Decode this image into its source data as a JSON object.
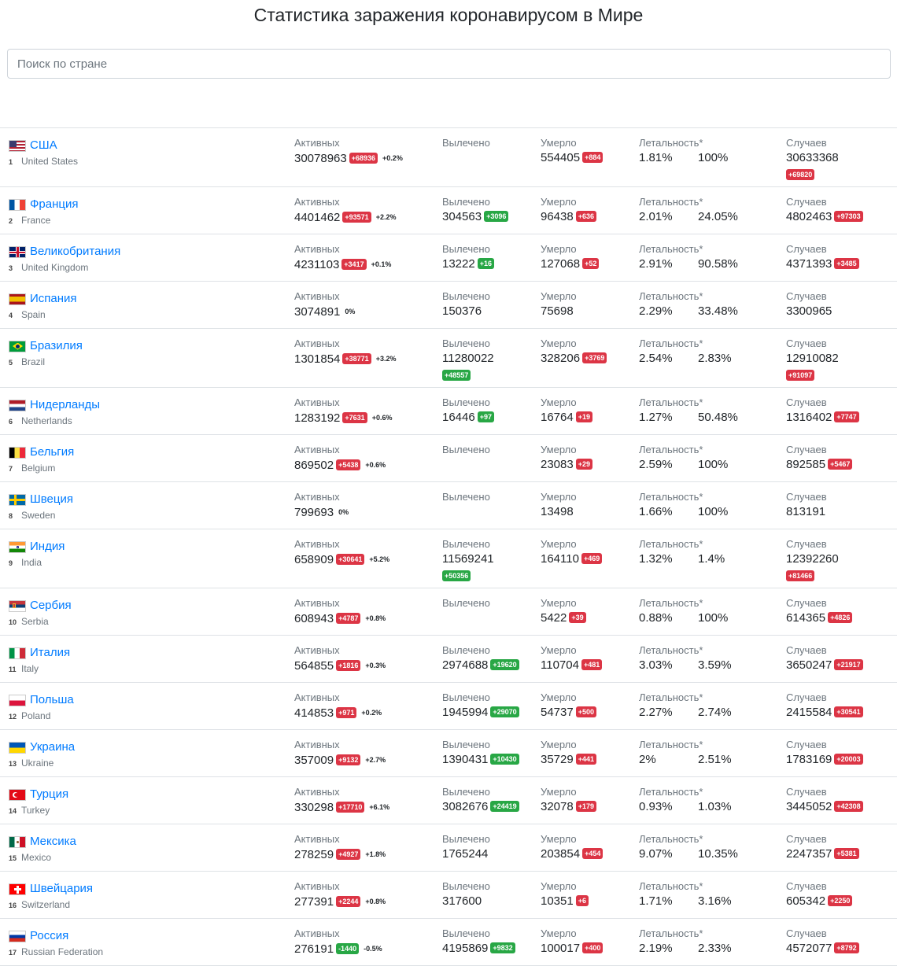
{
  "page_title": "Статистика заражения коронавирусом в Мире",
  "search": {
    "placeholder": "Поиск по стране"
  },
  "labels": {
    "active": "Активных",
    "recovered": "Вылечено",
    "deaths": "Умерло",
    "lethality": "Летальность*",
    "cases": "Случаев"
  },
  "rows": [
    {
      "rank": "1",
      "name": "США",
      "en": "United States",
      "flag": "us",
      "active": "30078963",
      "active_delta": "+68936",
      "active_pct": "+0.2%",
      "recovered": "",
      "recovered_delta": "",
      "deaths": "554405",
      "deaths_delta": "+884",
      "lethal": "1.81%",
      "lethal2": "100%",
      "cases": "30633368",
      "cases_delta": "+69820"
    },
    {
      "rank": "2",
      "name": "Франция",
      "en": "France",
      "flag": "fr",
      "active": "4401462",
      "active_delta": "+93571",
      "active_pct": "+2.2%",
      "recovered": "304563",
      "recovered_delta": "+3096",
      "deaths": "96438",
      "deaths_delta": "+636",
      "lethal": "2.01%",
      "lethal2": "24.05%",
      "cases": "4802463",
      "cases_delta": "+97303"
    },
    {
      "rank": "3",
      "name": "Великобритания",
      "en": "United Kingdom",
      "flag": "gb",
      "active": "4231103",
      "active_delta": "+3417",
      "active_pct": "+0.1%",
      "recovered": "13222",
      "recovered_delta": "+16",
      "deaths": "127068",
      "deaths_delta": "+52",
      "lethal": "2.91%",
      "lethal2": "90.58%",
      "cases": "4371393",
      "cases_delta": "+3485"
    },
    {
      "rank": "4",
      "name": "Испания",
      "en": "Spain",
      "flag": "es",
      "active": "3074891",
      "active_delta": "",
      "active_pct": "0%",
      "recovered": "150376",
      "recovered_delta": "",
      "deaths": "75698",
      "deaths_delta": "",
      "lethal": "2.29%",
      "lethal2": "33.48%",
      "cases": "3300965",
      "cases_delta": ""
    },
    {
      "rank": "5",
      "name": "Бразилия",
      "en": "Brazil",
      "flag": "br",
      "active": "1301854",
      "active_delta": "+38771",
      "active_pct": "+3.2%",
      "recovered": "11280022",
      "recovered_delta": "+48557",
      "deaths": "328206",
      "deaths_delta": "+3769",
      "lethal": "2.54%",
      "lethal2": "2.83%",
      "cases": "12910082",
      "cases_delta": "+91097"
    },
    {
      "rank": "6",
      "name": "Нидерланды",
      "en": "Netherlands",
      "flag": "nl",
      "active": "1283192",
      "active_delta": "+7631",
      "active_pct": "+0.6%",
      "recovered": "16446",
      "recovered_delta": "+97",
      "deaths": "16764",
      "deaths_delta": "+19",
      "lethal": "1.27%",
      "lethal2": "50.48%",
      "cases": "1316402",
      "cases_delta": "+7747"
    },
    {
      "rank": "7",
      "name": "Бельгия",
      "en": "Belgium",
      "flag": "be",
      "active": "869502",
      "active_delta": "+5438",
      "active_pct": "+0.6%",
      "recovered": "",
      "recovered_delta": "",
      "deaths": "23083",
      "deaths_delta": "+29",
      "lethal": "2.59%",
      "lethal2": "100%",
      "cases": "892585",
      "cases_delta": "+5467"
    },
    {
      "rank": "8",
      "name": "Швеция",
      "en": "Sweden",
      "flag": "se",
      "active": "799693",
      "active_delta": "",
      "active_pct": "0%",
      "recovered": "",
      "recovered_delta": "",
      "deaths": "13498",
      "deaths_delta": "",
      "lethal": "1.66%",
      "lethal2": "100%",
      "cases": "813191",
      "cases_delta": ""
    },
    {
      "rank": "9",
      "name": "Индия",
      "en": "India",
      "flag": "in",
      "active": "658909",
      "active_delta": "+30641",
      "active_pct": "+5.2%",
      "recovered": "11569241",
      "recovered_delta": "+50356",
      "deaths": "164110",
      "deaths_delta": "+469",
      "lethal": "1.32%",
      "lethal2": "1.4%",
      "cases": "12392260",
      "cases_delta": "+81466"
    },
    {
      "rank": "10",
      "name": "Сербия",
      "en": "Serbia",
      "flag": "rs",
      "active": "608943",
      "active_delta": "+4787",
      "active_pct": "+0.8%",
      "recovered": "",
      "recovered_delta": "",
      "deaths": "5422",
      "deaths_delta": "+39",
      "lethal": "0.88%",
      "lethal2": "100%",
      "cases": "614365",
      "cases_delta": "+4826"
    },
    {
      "rank": "11",
      "name": "Италия",
      "en": "Italy",
      "flag": "it",
      "active": "564855",
      "active_delta": "+1816",
      "active_pct": "+0.3%",
      "recovered": "2974688",
      "recovered_delta": "+19620",
      "deaths": "110704",
      "deaths_delta": "+481",
      "lethal": "3.03%",
      "lethal2": "3.59%",
      "cases": "3650247",
      "cases_delta": "+21917"
    },
    {
      "rank": "12",
      "name": "Польша",
      "en": "Poland",
      "flag": "pl",
      "active": "414853",
      "active_delta": "+971",
      "active_pct": "+0.2%",
      "recovered": "1945994",
      "recovered_delta": "+29070",
      "deaths": "54737",
      "deaths_delta": "+500",
      "lethal": "2.27%",
      "lethal2": "2.74%",
      "cases": "2415584",
      "cases_delta": "+30541"
    },
    {
      "rank": "13",
      "name": "Украина",
      "en": "Ukraine",
      "flag": "ua",
      "active": "357009",
      "active_delta": "+9132",
      "active_pct": "+2.7%",
      "recovered": "1390431",
      "recovered_delta": "+10430",
      "deaths": "35729",
      "deaths_delta": "+441",
      "lethal": "2%",
      "lethal2": "2.51%",
      "cases": "1783169",
      "cases_delta": "+20003"
    },
    {
      "rank": "14",
      "name": "Турция",
      "en": "Turkey",
      "flag": "tr",
      "active": "330298",
      "active_delta": "+17710",
      "active_pct": "+6.1%",
      "recovered": "3082676",
      "recovered_delta": "+24419",
      "deaths": "32078",
      "deaths_delta": "+179",
      "lethal": "0.93%",
      "lethal2": "1.03%",
      "cases": "3445052",
      "cases_delta": "+42308"
    },
    {
      "rank": "15",
      "name": "Мексика",
      "en": "Mexico",
      "flag": "mx",
      "active": "278259",
      "active_delta": "+4927",
      "active_pct": "+1.8%",
      "recovered": "1765244",
      "recovered_delta": "",
      "deaths": "203854",
      "deaths_delta": "+454",
      "lethal": "9.07%",
      "lethal2": "10.35%",
      "cases": "2247357",
      "cases_delta": "+5381"
    },
    {
      "rank": "16",
      "name": "Швейцария",
      "en": "Switzerland",
      "flag": "ch",
      "active": "277391",
      "active_delta": "+2244",
      "active_pct": "+0.8%",
      "recovered": "317600",
      "recovered_delta": "",
      "deaths": "10351",
      "deaths_delta": "+6",
      "lethal": "1.71%",
      "lethal2": "3.16%",
      "cases": "605342",
      "cases_delta": "+2250"
    },
    {
      "rank": "17",
      "name": "Россия",
      "en": "Russian Federation",
      "flag": "ru",
      "active": "276191",
      "active_delta": "-1440",
      "active_pct": "-0.5%",
      "recovered": "4195869",
      "recovered_delta": "+9832",
      "deaths": "100017",
      "deaths_delta": "+400",
      "lethal": "2.19%",
      "lethal2": "2.33%",
      "cases": "4572077",
      "cases_delta": "+8792"
    }
  ]
}
